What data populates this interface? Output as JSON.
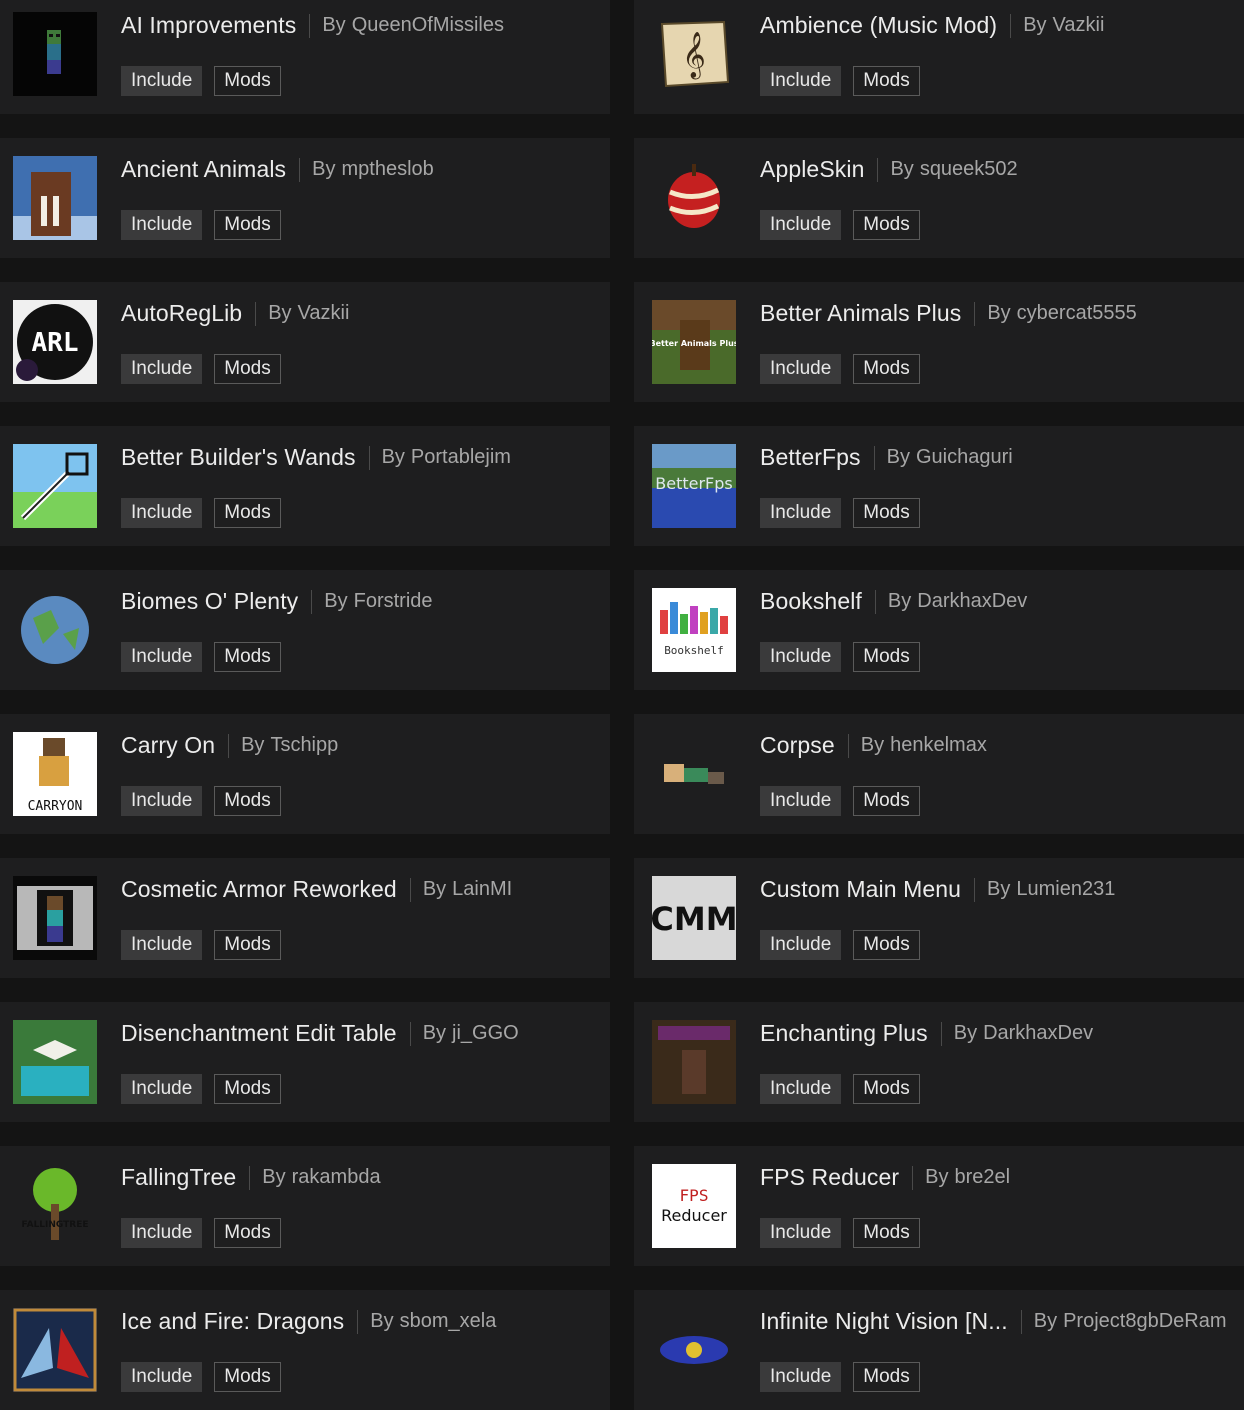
{
  "by_label": "By",
  "tag_include": "Include",
  "tag_mods": "Mods",
  "colors": {
    "background": "#141414",
    "card": "#1e1e1f",
    "include_bg": "#3a3a3b",
    "mods_border": "#5a5a5a"
  },
  "mods": [
    {
      "name": "AI Improvements",
      "author": "QueenOfMissiles",
      "icon": "zombie-icon"
    },
    {
      "name": "Ambience (Music Mod)",
      "author": "Vazkii",
      "icon": "music-scroll-icon"
    },
    {
      "name": "Ancient Animals",
      "author": "mptheslob",
      "icon": "mammoth-icon"
    },
    {
      "name": "AppleSkin",
      "author": "squeek502",
      "icon": "apple-peel-icon"
    },
    {
      "name": "AutoRegLib",
      "author": "Vazkii",
      "icon": "arl-logo-icon",
      "icon_text": "ARL"
    },
    {
      "name": "Better Animals Plus",
      "author": "cybercat5555",
      "icon": "better-animals-icon",
      "icon_text": "Better Animals Plus"
    },
    {
      "name": "Better Builder's Wands",
      "author": "Portablejim",
      "icon": "wand-icon"
    },
    {
      "name": "BetterFps",
      "author": "Guichaguri",
      "icon": "betterfps-icon",
      "icon_text": "BetterFps"
    },
    {
      "name": "Biomes O' Plenty",
      "author": "Forstride",
      "icon": "globe-icon"
    },
    {
      "name": "Bookshelf",
      "author": "DarkhaxDev",
      "icon": "bookshelf-icon",
      "icon_text": "Bookshelf"
    },
    {
      "name": "Carry On",
      "author": "Tschipp",
      "icon": "carry-on-icon",
      "icon_text": "CARRYON"
    },
    {
      "name": "Corpse",
      "author": "henkelmax",
      "icon": "corpse-icon"
    },
    {
      "name": "Cosmetic Armor Reworked",
      "author": "LainMI",
      "icon": "armor-inventory-icon"
    },
    {
      "name": "Custom Main Menu",
      "author": "Lumien231",
      "icon": "cmm-icon",
      "icon_text": "CMM"
    },
    {
      "name": "Disenchantment Edit Table",
      "author": "ji_GGO",
      "icon": "enchant-table-icon"
    },
    {
      "name": "Enchanting Plus",
      "author": "DarkhaxDev",
      "icon": "enchanting-plus-icon"
    },
    {
      "name": "FallingTree",
      "author": "rakambda",
      "icon": "tree-icon",
      "icon_text": "FALLINGTREE"
    },
    {
      "name": "FPS Reducer",
      "author": "bre2el",
      "icon": "fps-reducer-icon",
      "icon_text_1": "FPS",
      "icon_text_2": "Reducer"
    },
    {
      "name": "Ice and Fire: Dragons",
      "author": "sbom_xela",
      "icon": "dragons-icon"
    },
    {
      "name": "Infinite Night Vision [N...",
      "author": "Project8gbDeRam",
      "icon": "night-vision-eye-icon"
    }
  ]
}
